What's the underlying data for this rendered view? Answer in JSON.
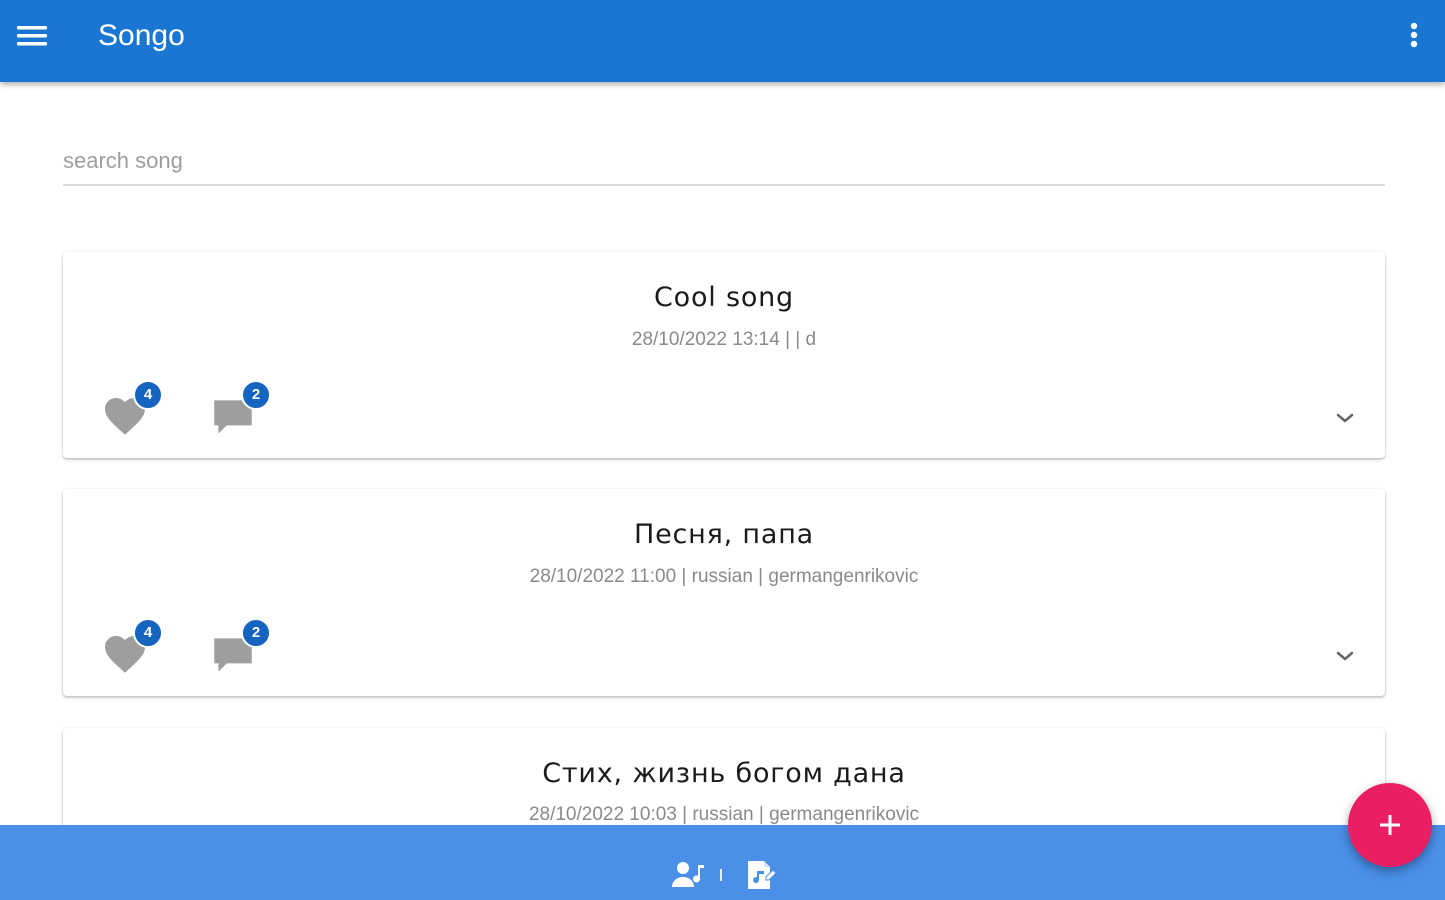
{
  "app": {
    "title": "Songo"
  },
  "search": {
    "placeholder": "search song",
    "value": ""
  },
  "songs": [
    {
      "title": "Cool song",
      "meta": "28/10/2022 13:14 | | d",
      "likes": "4",
      "comments": "2"
    },
    {
      "title": "Песня, папа",
      "meta": "28/10/2022 11:00 | russian | germangenrikovic",
      "likes": "4",
      "comments": "2"
    },
    {
      "title": "Стих, жизнь богом дана",
      "meta": "28/10/2022 10:03 | russian | germangenrikovic"
    }
  ],
  "colors": {
    "appbar": "#1976d2",
    "bottombar": "#4a8fe8",
    "fab": "#e91e63",
    "badge": "#1565c0",
    "action_icon": "#9e9e9e"
  },
  "icons": {
    "menu": "menu-icon",
    "more": "more-vert-icon",
    "like": "heart-icon",
    "comment": "comment-icon",
    "expand": "chevron-down-icon",
    "add": "plus-icon",
    "artists": "artists-icon",
    "songs": "songs-icon"
  }
}
